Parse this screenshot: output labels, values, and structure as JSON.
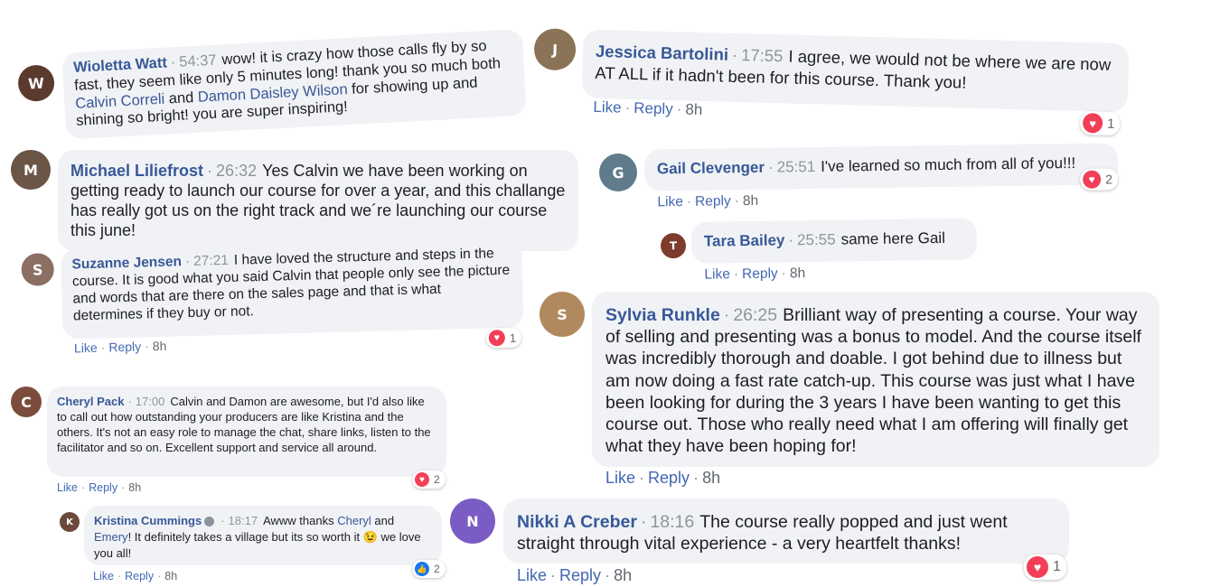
{
  "comments": {
    "wioletta": {
      "name": "Wioletta Watt",
      "time": "54:37",
      "text1": "wow! it is crazy how those calls fly by so fast, they seem like only 5 minutes long! thank you so much both ",
      "mention1": "Calvin Correli",
      "text2": " and ",
      "mention2": "Damon Daisley Wilson",
      "text3": " for showing up and shining so bright! you are super inspiring!"
    },
    "michael": {
      "name": "Michael Liliefrost",
      "time": "26:32",
      "text": "Yes Calvin we have been working on getting ready to launch our course for over a year, and this challange has really got us on the right track and we´re launching our course this june!"
    },
    "suzanne": {
      "name": "Suzanne Jensen",
      "time": "27:21",
      "text": "I have loved the structure and steps in the course. It is good what you said Calvin that people only see the picture and words that are there on the sales page and that is what determines if they buy or not.",
      "like": "Like",
      "reply": "Reply",
      "age": "8h",
      "reactions": "1"
    },
    "cheryl": {
      "name": "Cheryl Pack",
      "time": "17:00",
      "text": "Calvin and Damon are awesome, but I'd also like to call out how outstanding your producers are like Kristina and the others. It's not an easy role to manage the chat, share links, listen to the facilitator and so on. Excellent support and service all around.",
      "like": "Like",
      "reply": "Reply",
      "age": "8h",
      "reactions": "2"
    },
    "kristina": {
      "name": "Kristina Cummings",
      "time": "18:17",
      "text1": "Awww thanks ",
      "mention1": "Cheryl",
      "text2": " and ",
      "mention2": "Emery",
      "text3": "! It definitely takes a village but its so worth it 😉 we love you all!",
      "like": "Like",
      "reply": "Reply",
      "age": "8h",
      "reactions": "2"
    },
    "jessica": {
      "name": "Jessica Bartolini",
      "time": "17:55",
      "text": "I agree, we would not be where we are now AT ALL if it hadn't been for this course. Thank you!",
      "like": "Like",
      "reply": "Reply",
      "age": "8h",
      "reactions": "1"
    },
    "gail": {
      "name": "Gail Clevenger",
      "time": "25:51",
      "text": "I've learned so much from all of you!!!",
      "like": "Like",
      "reply": "Reply",
      "age": "8h",
      "reactions": "2"
    },
    "tara": {
      "name": "Tara Bailey",
      "time": "25:55",
      "text": "same here Gail",
      "like": "Like",
      "reply": "Reply",
      "age": "8h"
    },
    "sylvia": {
      "name": "Sylvia Runkle",
      "time": "26:25",
      "text": "Brilliant way of presenting a course. Your way of selling and presenting was a bonus to model. And the course itself was incredibly thorough and doable. I got behind due to illness but am now doing a fast rate catch-up. This course was just what I have been looking for during the 3 years I have been wanting to get this course out. Those who really need what I am offering will finally get what they have been hoping for!",
      "like": "Like",
      "reply": "Reply",
      "age": "8h"
    },
    "nikki": {
      "name": "Nikki A Creber",
      "time": "18:16",
      "text": "The course really popped and just went straight through vital experience - a very heartfelt thanks!",
      "like": "Like",
      "reply": "Reply",
      "age": "8h",
      "reactions": "1"
    }
  },
  "colors": {
    "name": "#385898",
    "action": "#4267b2",
    "bubble": "#f0f2f5",
    "heart": "#f33e58",
    "like": "#1877f2"
  },
  "icons": {
    "reaction_love": "heart-icon",
    "reaction_like": "thumbs-up-icon",
    "verified": "verified-badge-icon"
  }
}
